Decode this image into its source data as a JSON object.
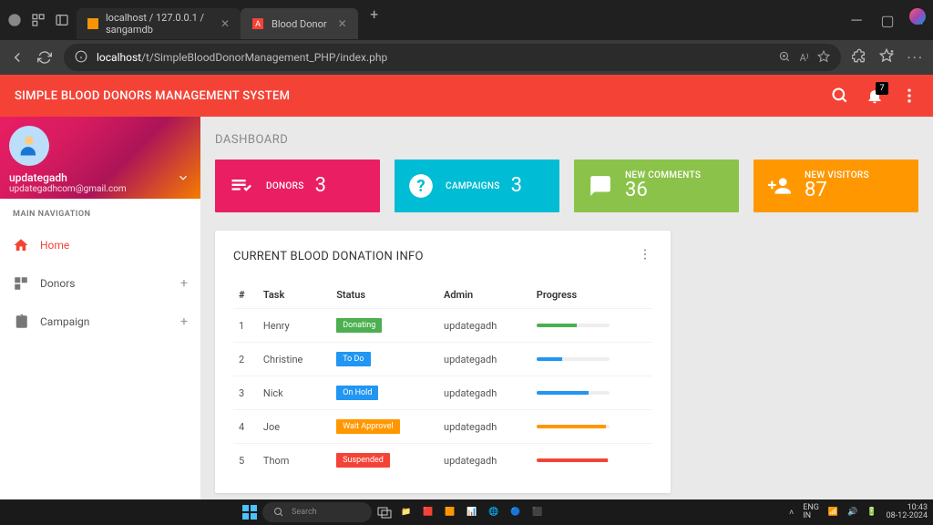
{
  "browser": {
    "tabs": [
      {
        "title": "localhost / 127.0.0.1 / sangamdb"
      },
      {
        "title": "Blood Donor"
      }
    ],
    "url_host": "localhost",
    "url_path": "/t/SimpleBloodDonorManagement_PHP/index.php"
  },
  "topbar": {
    "title": "SIMPLE BLOOD DONORS MANAGEMENT SYSTEM",
    "notif_count": "7"
  },
  "user": {
    "name": "updategadh",
    "email": "updategadhcom@gmail.com"
  },
  "nav": {
    "title": "MAIN NAVIGATION",
    "items": [
      {
        "label": "Home",
        "active": true
      },
      {
        "label": "Donors",
        "expandable": true
      },
      {
        "label": "Campaign",
        "expandable": true
      }
    ]
  },
  "page": {
    "title": "DASHBOARD"
  },
  "stats": [
    {
      "label": "DONORS",
      "value": "3",
      "color": "pink"
    },
    {
      "label": "CAMPAIGNS",
      "value": "3",
      "color": "cyan"
    },
    {
      "label": "NEW COMMENTS",
      "value": "36",
      "color": "green"
    },
    {
      "label": "NEW VISITORS",
      "value": "87",
      "color": "orange"
    }
  ],
  "card": {
    "title": "CURRENT BLOOD DONATION INFO",
    "headers": {
      "num": "#",
      "task": "Task",
      "status": "Status",
      "admin": "Admin",
      "progress": "Progress"
    },
    "rows": [
      {
        "num": "1",
        "task": "Henry",
        "status": "Donating",
        "status_cls": "b-green",
        "admin": "updategadh",
        "pct": 55,
        "pcolor": "#4caf50"
      },
      {
        "num": "2",
        "task": "Christine",
        "status": "To Do",
        "status_cls": "b-blue",
        "admin": "updategadh",
        "pct": 35,
        "pcolor": "#2196f3"
      },
      {
        "num": "3",
        "task": "Nick",
        "status": "On Hold",
        "status_cls": "b-blue",
        "admin": "updategadh",
        "pct": 72,
        "pcolor": "#2196f3"
      },
      {
        "num": "4",
        "task": "Joe",
        "status": "Wait Approvel",
        "status_cls": "b-orange",
        "admin": "updategadh",
        "pct": 95,
        "pcolor": "#ff9800"
      },
      {
        "num": "5",
        "task": "Thom",
        "status": "Suspended",
        "status_cls": "b-red",
        "admin": "updategadh",
        "pct": 98,
        "pcolor": "#f44336"
      }
    ]
  },
  "taskbar": {
    "search_placeholder": "Search",
    "lang1": "ENG",
    "lang2": "IN",
    "time": "10:43",
    "date": "08-12-2024"
  }
}
